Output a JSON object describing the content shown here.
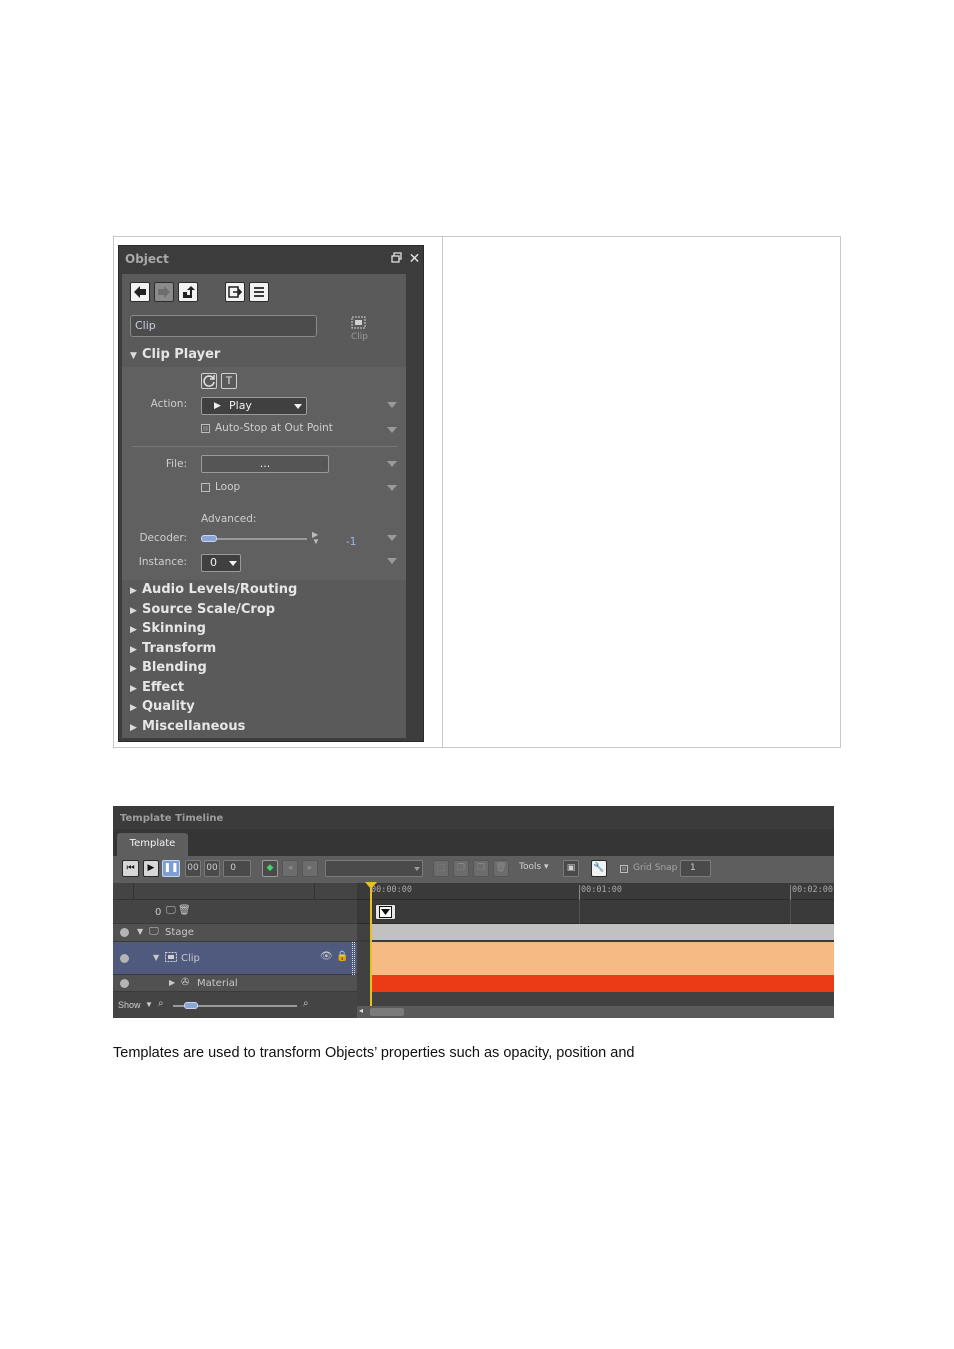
{
  "object_panel": {
    "title": "Object",
    "clip_name": "Clip",
    "clip_icon_label": "Clip",
    "clip_player": {
      "header": "Clip Player",
      "action_label": "Action:",
      "action_value": "Play",
      "auto_stop_label": "Auto-Stop at Out Point",
      "file_label": "File:",
      "file_button": "...",
      "loop_label": "Loop",
      "advanced_label": "Advanced:",
      "decoder_label": "Decoder:",
      "decoder_value": "-1",
      "instance_label": "Instance:",
      "instance_value": "0"
    },
    "sections": [
      "Audio Levels/Routing",
      "Source Scale/Crop",
      "Skinning",
      "Transform",
      "Blending",
      "Effect",
      "Quality",
      "Miscellaneous"
    ]
  },
  "timeline": {
    "title": "Template Timeline",
    "tab": "Template",
    "toolbar": {
      "field_a": "00",
      "field_b": "00",
      "field_c": "0",
      "tools_label": "Tools",
      "grid_snap_label": "Grid Snap",
      "grid_snap_value": "1"
    },
    "ticks": [
      "00:00:00",
      "00:01:00",
      "00:02:00"
    ],
    "header_count": "0",
    "rows": [
      {
        "label": "Stage",
        "color": "#c1c1c1"
      },
      {
        "label": "Clip",
        "color": "#f6bb85"
      },
      {
        "label": "Material",
        "color": "#ea3a16"
      }
    ],
    "show_label": "Show"
  },
  "body_text": "Templates are used to transform Objects’ properties such as opacity, position and"
}
